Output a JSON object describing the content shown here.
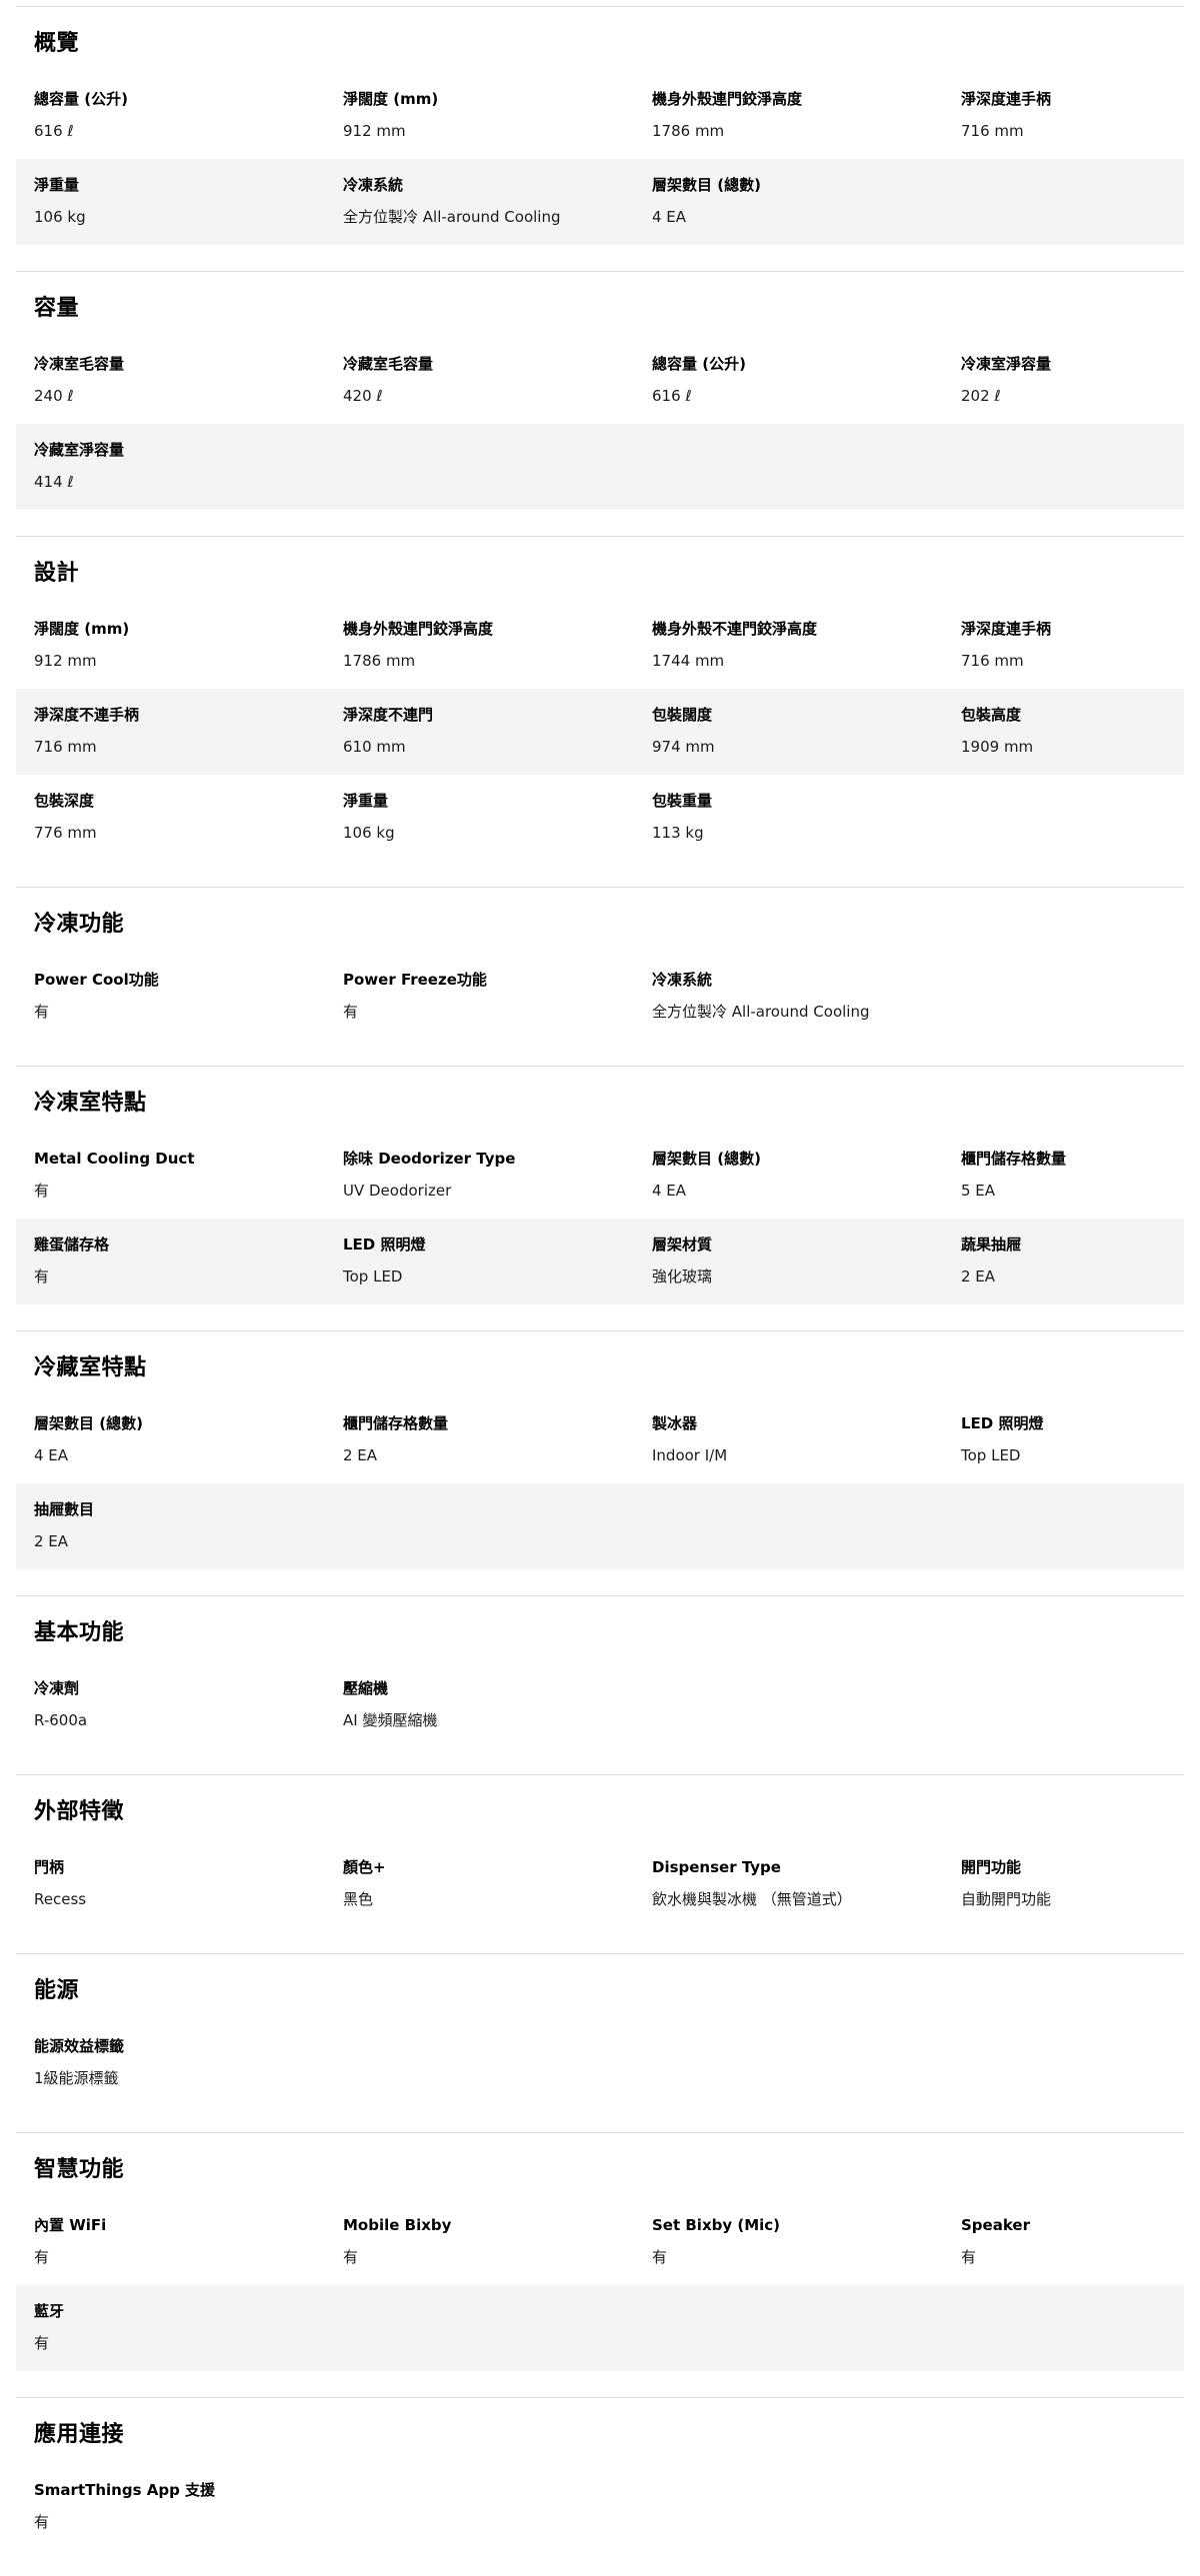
{
  "sections": [
    {
      "title": "概覽",
      "rows": [
        [
          {
            "label": "總容量 (公升)",
            "value": "616 ℓ"
          },
          {
            "label": "淨闊度 (mm)",
            "value": "912 mm"
          },
          {
            "label": "機身外殼連門鉸淨高度",
            "value": "1786 mm"
          },
          {
            "label": "淨深度連手柄",
            "value": "716 mm"
          }
        ],
        [
          {
            "label": "淨重量",
            "value": "106 kg"
          },
          {
            "label": "冷凍系統",
            "value": "全方位製冷 All-around Cooling"
          },
          {
            "label": "層架數目 (總數)",
            "value": "4 EA"
          }
        ]
      ]
    },
    {
      "title": "容量",
      "rows": [
        [
          {
            "label": "冷凍室毛容量",
            "value": "240 ℓ"
          },
          {
            "label": "冷藏室毛容量",
            "value": "420 ℓ"
          },
          {
            "label": "總容量 (公升)",
            "value": "616 ℓ"
          },
          {
            "label": "冷凍室淨容量",
            "value": "202 ℓ"
          }
        ],
        [
          {
            "label": "冷藏室淨容量",
            "value": "414 ℓ"
          }
        ]
      ]
    },
    {
      "title": "設計",
      "rows": [
        [
          {
            "label": "淨闊度 (mm)",
            "value": "912 mm"
          },
          {
            "label": "機身外殼連門鉸淨高度",
            "value": "1786 mm"
          },
          {
            "label": "機身外殼不連門鉸淨高度",
            "value": "1744 mm"
          },
          {
            "label": "淨深度連手柄",
            "value": "716 mm"
          }
        ],
        [
          {
            "label": "淨深度不連手柄",
            "value": "716 mm"
          },
          {
            "label": "淨深度不連門",
            "value": "610 mm"
          },
          {
            "label": "包裝闊度",
            "value": "974 mm"
          },
          {
            "label": "包裝高度",
            "value": "1909 mm"
          }
        ],
        [
          {
            "label": "包裝深度",
            "value": "776 mm"
          },
          {
            "label": "淨重量",
            "value": "106 kg"
          },
          {
            "label": "包裝重量",
            "value": "113 kg"
          }
        ]
      ]
    },
    {
      "title": "冷凍功能",
      "rows": [
        [
          {
            "label": "Power Cool功能",
            "value": "有"
          },
          {
            "label": "Power Freeze功能",
            "value": "有"
          },
          {
            "label": "冷凍系統",
            "value": "全方位製冷 All-around Cooling"
          }
        ]
      ]
    },
    {
      "title": "冷凍室特點",
      "rows": [
        [
          {
            "label": "Metal Cooling Duct",
            "value": "有"
          },
          {
            "label": "除味 Deodorizer Type",
            "value": "UV Deodorizer"
          },
          {
            "label": "層架數目 (總數)",
            "value": "4 EA"
          },
          {
            "label": "櫃門儲存格數量",
            "value": "5 EA"
          }
        ],
        [
          {
            "label": "雞蛋儲存格",
            "value": "有"
          },
          {
            "label": "LED 照明燈",
            "value": "Top LED"
          },
          {
            "label": "層架材質",
            "value": "強化玻璃"
          },
          {
            "label": "蔬果抽屜",
            "value": "2 EA"
          }
        ]
      ]
    },
    {
      "title": "冷藏室特點",
      "rows": [
        [
          {
            "label": "層架數目 (總數)",
            "value": "4 EA"
          },
          {
            "label": "櫃門儲存格數量",
            "value": "2 EA"
          },
          {
            "label": "製冰器",
            "value": "Indoor I/M"
          },
          {
            "label": "LED 照明燈",
            "value": "Top LED"
          }
        ],
        [
          {
            "label": "抽屜數目",
            "value": "2 EA"
          }
        ]
      ]
    },
    {
      "title": "基本功能",
      "rows": [
        [
          {
            "label": "冷凍劑",
            "value": "R-600a"
          },
          {
            "label": "壓縮機",
            "value": "AI 變頻壓縮機"
          }
        ]
      ]
    },
    {
      "title": "外部特徵",
      "rows": [
        [
          {
            "label": "門柄",
            "value": "Recess"
          },
          {
            "label": "顏色+",
            "value": "黑色"
          },
          {
            "label": "Dispenser Type",
            "value": "飲水機與製冰機 （無管道式）"
          },
          {
            "label": "開門功能",
            "value": "自動開門功能"
          }
        ]
      ]
    },
    {
      "title": "能源",
      "rows": [
        [
          {
            "label": "能源效益標籤",
            "value": "1級能源標籤"
          }
        ]
      ]
    },
    {
      "title": "智慧功能",
      "rows": [
        [
          {
            "label": "內置 WiFi",
            "value": "有"
          },
          {
            "label": "Mobile Bixby",
            "value": "有"
          },
          {
            "label": "Set Bixby (Mic)",
            "value": "有"
          },
          {
            "label": "Speaker",
            "value": "有"
          }
        ],
        [
          {
            "label": "藍牙",
            "value": "有"
          }
        ]
      ]
    },
    {
      "title": "應用連接",
      "rows": [
        [
          {
            "label": "SmartThings App 支援",
            "value": "有"
          }
        ]
      ]
    }
  ]
}
